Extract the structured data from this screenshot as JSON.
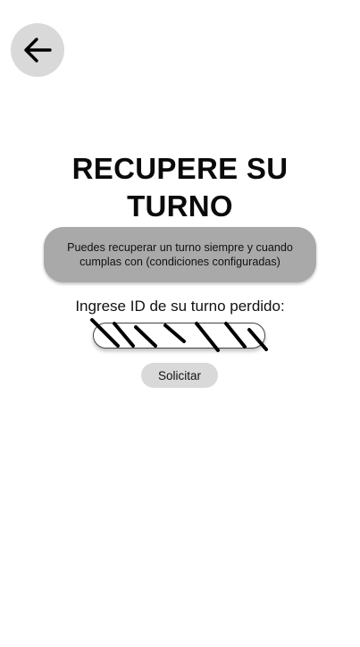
{
  "header": {
    "back_icon": "arrow-left-icon"
  },
  "page": {
    "title_line1": "RECUPERE SU",
    "title_line2": "TURNO",
    "info_line1": "Puedes recuperar un turno siempre y cuando",
    "info_line2": "cumplas con (condiciones configuradas)",
    "input_label": "Ingrese ID de su turno perdido:",
    "submit_label": "Solicitar"
  }
}
